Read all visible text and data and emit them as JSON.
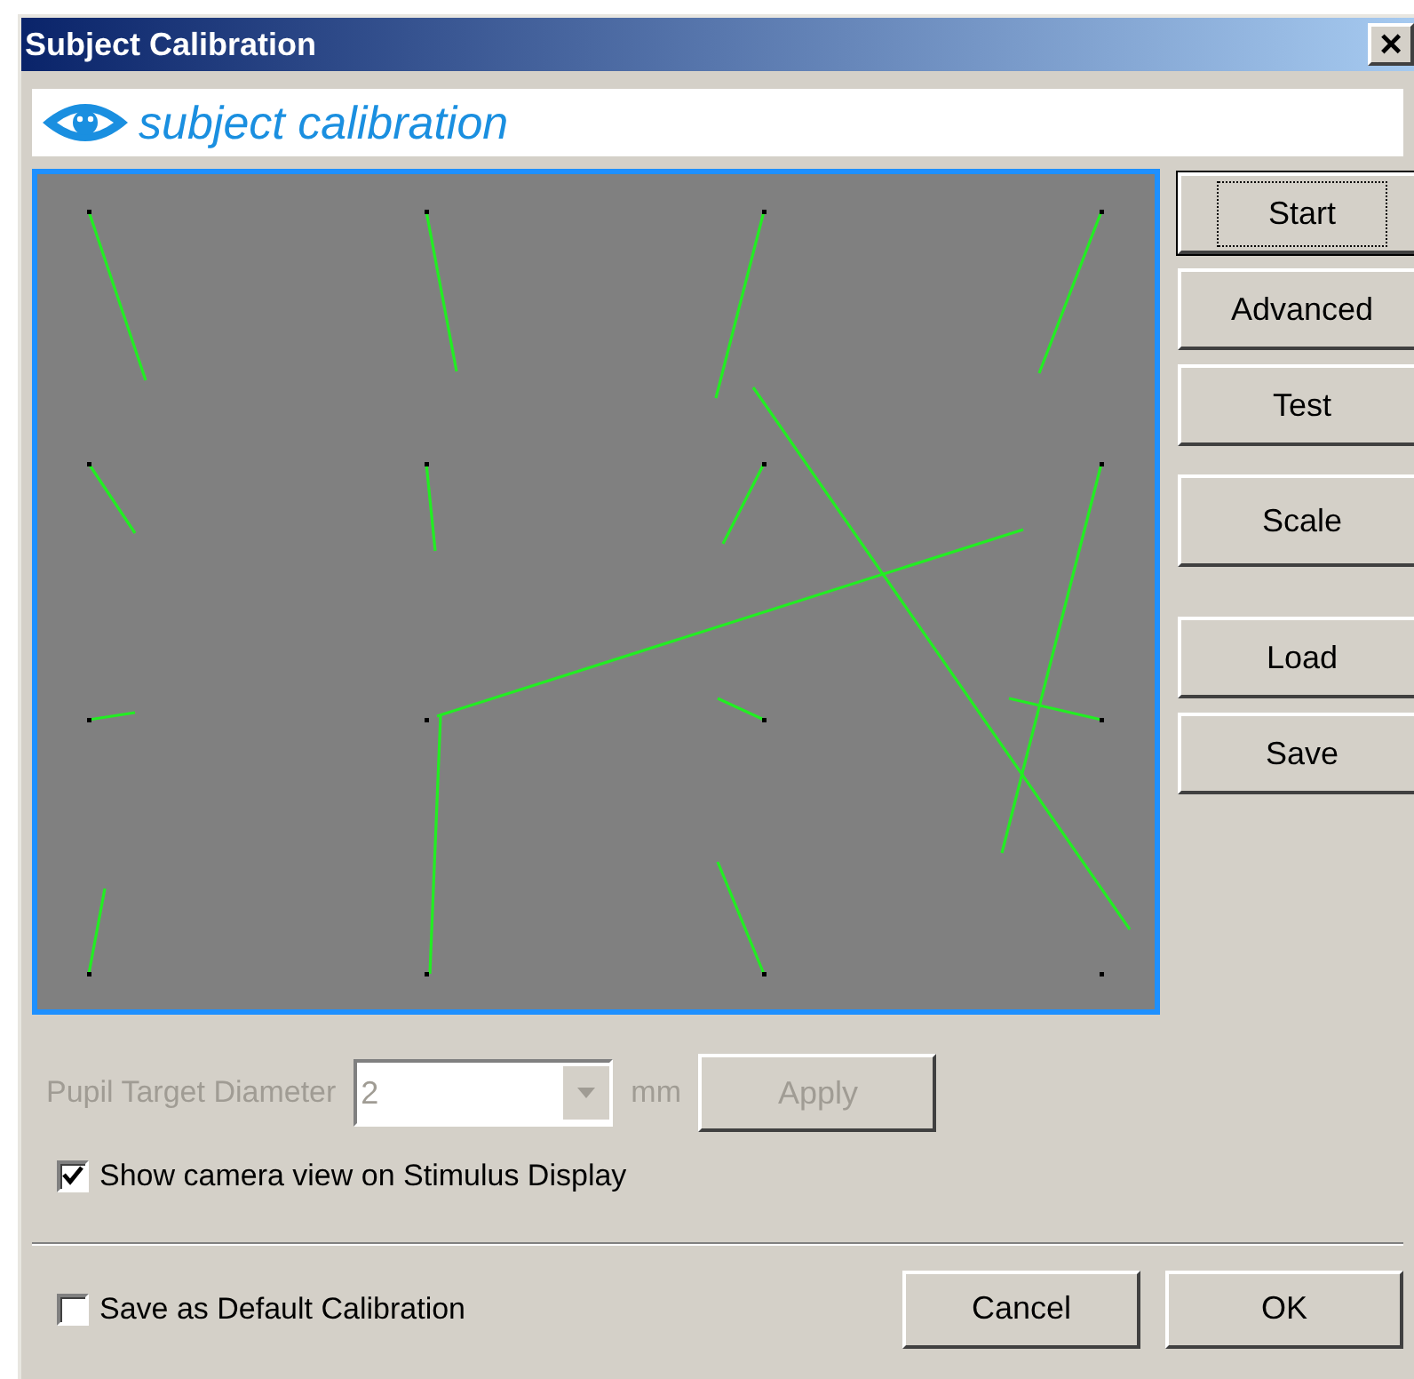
{
  "window": {
    "title": "Subject Calibration",
    "close": "×"
  },
  "banner": {
    "title": "subject calibration"
  },
  "side_buttons": [
    {
      "label": "Start",
      "default": true
    },
    {
      "label": "Advanced",
      "default": false
    },
    {
      "label": "Test",
      "default": false
    },
    {
      "label": "Scale",
      "default": false
    },
    {
      "label": "Load",
      "default": false
    },
    {
      "label": "Save",
      "default": false
    }
  ],
  "pupil": {
    "label": "Pupil Target Diameter",
    "value": "2",
    "unit": "mm",
    "apply": "Apply",
    "disabled": true
  },
  "show_camera": {
    "label": "Show camera view on Stimulus Display",
    "checked": true
  },
  "save_default": {
    "label": "Save as Default Calibration",
    "checked": false
  },
  "footer_buttons": [
    "Cancel",
    "OK"
  ]
}
